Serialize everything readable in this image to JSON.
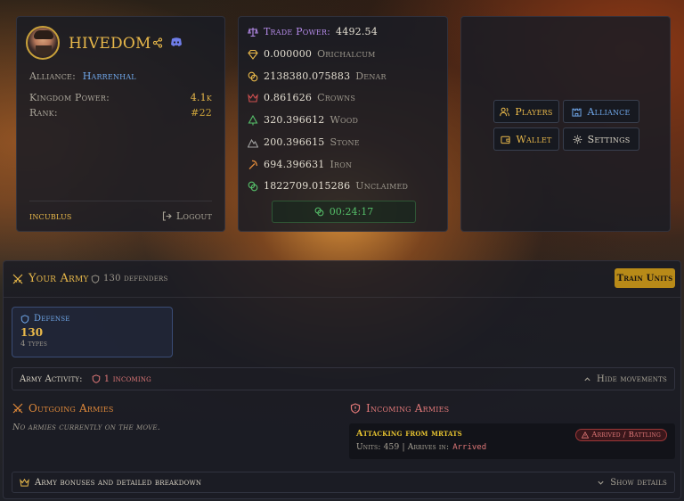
{
  "profile": {
    "username": "HIVEDOM",
    "alliance_label": "Alliance:",
    "alliance_name": "Harrenhal",
    "kingdom_power_label": "Kingdom Power:",
    "kingdom_power_value": "4.1k",
    "rank_label": "Rank:",
    "rank_value": "#22",
    "account_name": "incublus",
    "logout_label": "Logout"
  },
  "resources": {
    "trade_power_label": "Trade Power:",
    "trade_power_value": "4492.54",
    "items": [
      {
        "value": "0.000000",
        "label": "Orichalcum",
        "icon": "diamond-icon",
        "color": "#e8b84a"
      },
      {
        "value": "2138380.075883",
        "label": "Denar",
        "icon": "coins-icon",
        "color": "#e8b84a"
      },
      {
        "value": "0.861626",
        "label": "Crowns",
        "icon": "crown-icon",
        "color": "#d05050"
      },
      {
        "value": "320.396612",
        "label": "Wood",
        "icon": "tree-icon",
        "color": "#56c06a"
      },
      {
        "value": "200.396615",
        "label": "Stone",
        "icon": "mountain-icon",
        "color": "#a0a0a0"
      },
      {
        "value": "694.396631",
        "label": "Iron",
        "icon": "pickaxe-icon",
        "color": "#e0893a"
      },
      {
        "value": "1822709.015286",
        "label": "Unclaimed",
        "icon": "coins-icon",
        "color": "#56c06a"
      }
    ],
    "timer": "00:24:17"
  },
  "nav": {
    "players": "Players",
    "alliance": "Alliance",
    "wallet": "Wallet",
    "settings": "Settings"
  },
  "army": {
    "title": "Your Army",
    "defenders": "130 defenders",
    "train_button": "Train Units",
    "defense_label": "Defense",
    "defense_value": "130",
    "defense_types": "4 types",
    "activity_label": "Army Activity:",
    "incoming_count": "1 incoming",
    "hide_movements": "Hide movements",
    "outgoing_title": "Outgoing Armies",
    "outgoing_empty": "No armies currently on the move.",
    "incoming_title": "Incoming Armies",
    "attack_title": "Attacking from mrtats",
    "attack_units_label": "Units: 459 | Arrives in:",
    "attack_status": "Arrived",
    "attack_badge": "Arrived / Battling",
    "bonus_label": "Army bonuses and detailed breakdown",
    "show_details": "Show details"
  },
  "colors": {
    "gold": "#e8b84a",
    "blue": "#6fa6e8",
    "purple": "#b48ae8",
    "green": "#56c06a",
    "red": "#e07878"
  }
}
